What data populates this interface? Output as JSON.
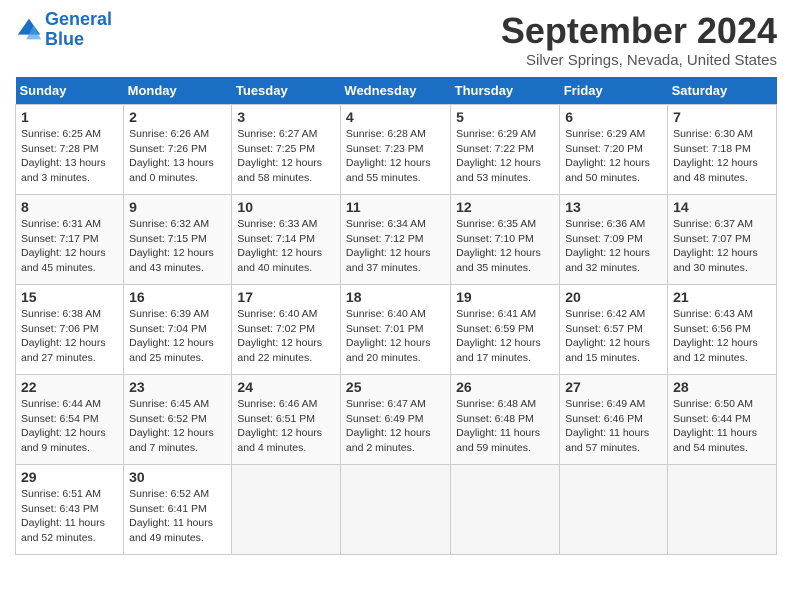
{
  "header": {
    "logo_line1": "General",
    "logo_line2": "Blue",
    "title": "September 2024",
    "location": "Silver Springs, Nevada, United States"
  },
  "weekdays": [
    "Sunday",
    "Monday",
    "Tuesday",
    "Wednesday",
    "Thursday",
    "Friday",
    "Saturday"
  ],
  "weeks": [
    [
      {
        "day": "1",
        "sunrise": "Sunrise: 6:25 AM",
        "sunset": "Sunset: 7:28 PM",
        "daylight": "Daylight: 13 hours and 3 minutes."
      },
      {
        "day": "2",
        "sunrise": "Sunrise: 6:26 AM",
        "sunset": "Sunset: 7:26 PM",
        "daylight": "Daylight: 13 hours and 0 minutes."
      },
      {
        "day": "3",
        "sunrise": "Sunrise: 6:27 AM",
        "sunset": "Sunset: 7:25 PM",
        "daylight": "Daylight: 12 hours and 58 minutes."
      },
      {
        "day": "4",
        "sunrise": "Sunrise: 6:28 AM",
        "sunset": "Sunset: 7:23 PM",
        "daylight": "Daylight: 12 hours and 55 minutes."
      },
      {
        "day": "5",
        "sunrise": "Sunrise: 6:29 AM",
        "sunset": "Sunset: 7:22 PM",
        "daylight": "Daylight: 12 hours and 53 minutes."
      },
      {
        "day": "6",
        "sunrise": "Sunrise: 6:29 AM",
        "sunset": "Sunset: 7:20 PM",
        "daylight": "Daylight: 12 hours and 50 minutes."
      },
      {
        "day": "7",
        "sunrise": "Sunrise: 6:30 AM",
        "sunset": "Sunset: 7:18 PM",
        "daylight": "Daylight: 12 hours and 48 minutes."
      }
    ],
    [
      {
        "day": "8",
        "sunrise": "Sunrise: 6:31 AM",
        "sunset": "Sunset: 7:17 PM",
        "daylight": "Daylight: 12 hours and 45 minutes."
      },
      {
        "day": "9",
        "sunrise": "Sunrise: 6:32 AM",
        "sunset": "Sunset: 7:15 PM",
        "daylight": "Daylight: 12 hours and 43 minutes."
      },
      {
        "day": "10",
        "sunrise": "Sunrise: 6:33 AM",
        "sunset": "Sunset: 7:14 PM",
        "daylight": "Daylight: 12 hours and 40 minutes."
      },
      {
        "day": "11",
        "sunrise": "Sunrise: 6:34 AM",
        "sunset": "Sunset: 7:12 PM",
        "daylight": "Daylight: 12 hours and 37 minutes."
      },
      {
        "day": "12",
        "sunrise": "Sunrise: 6:35 AM",
        "sunset": "Sunset: 7:10 PM",
        "daylight": "Daylight: 12 hours and 35 minutes."
      },
      {
        "day": "13",
        "sunrise": "Sunrise: 6:36 AM",
        "sunset": "Sunset: 7:09 PM",
        "daylight": "Daylight: 12 hours and 32 minutes."
      },
      {
        "day": "14",
        "sunrise": "Sunrise: 6:37 AM",
        "sunset": "Sunset: 7:07 PM",
        "daylight": "Daylight: 12 hours and 30 minutes."
      }
    ],
    [
      {
        "day": "15",
        "sunrise": "Sunrise: 6:38 AM",
        "sunset": "Sunset: 7:06 PM",
        "daylight": "Daylight: 12 hours and 27 minutes."
      },
      {
        "day": "16",
        "sunrise": "Sunrise: 6:39 AM",
        "sunset": "Sunset: 7:04 PM",
        "daylight": "Daylight: 12 hours and 25 minutes."
      },
      {
        "day": "17",
        "sunrise": "Sunrise: 6:40 AM",
        "sunset": "Sunset: 7:02 PM",
        "daylight": "Daylight: 12 hours and 22 minutes."
      },
      {
        "day": "18",
        "sunrise": "Sunrise: 6:40 AM",
        "sunset": "Sunset: 7:01 PM",
        "daylight": "Daylight: 12 hours and 20 minutes."
      },
      {
        "day": "19",
        "sunrise": "Sunrise: 6:41 AM",
        "sunset": "Sunset: 6:59 PM",
        "daylight": "Daylight: 12 hours and 17 minutes."
      },
      {
        "day": "20",
        "sunrise": "Sunrise: 6:42 AM",
        "sunset": "Sunset: 6:57 PM",
        "daylight": "Daylight: 12 hours and 15 minutes."
      },
      {
        "day": "21",
        "sunrise": "Sunrise: 6:43 AM",
        "sunset": "Sunset: 6:56 PM",
        "daylight": "Daylight: 12 hours and 12 minutes."
      }
    ],
    [
      {
        "day": "22",
        "sunrise": "Sunrise: 6:44 AM",
        "sunset": "Sunset: 6:54 PM",
        "daylight": "Daylight: 12 hours and 9 minutes."
      },
      {
        "day": "23",
        "sunrise": "Sunrise: 6:45 AM",
        "sunset": "Sunset: 6:52 PM",
        "daylight": "Daylight: 12 hours and 7 minutes."
      },
      {
        "day": "24",
        "sunrise": "Sunrise: 6:46 AM",
        "sunset": "Sunset: 6:51 PM",
        "daylight": "Daylight: 12 hours and 4 minutes."
      },
      {
        "day": "25",
        "sunrise": "Sunrise: 6:47 AM",
        "sunset": "Sunset: 6:49 PM",
        "daylight": "Daylight: 12 hours and 2 minutes."
      },
      {
        "day": "26",
        "sunrise": "Sunrise: 6:48 AM",
        "sunset": "Sunset: 6:48 PM",
        "daylight": "Daylight: 11 hours and 59 minutes."
      },
      {
        "day": "27",
        "sunrise": "Sunrise: 6:49 AM",
        "sunset": "Sunset: 6:46 PM",
        "daylight": "Daylight: 11 hours and 57 minutes."
      },
      {
        "day": "28",
        "sunrise": "Sunrise: 6:50 AM",
        "sunset": "Sunset: 6:44 PM",
        "daylight": "Daylight: 11 hours and 54 minutes."
      }
    ],
    [
      {
        "day": "29",
        "sunrise": "Sunrise: 6:51 AM",
        "sunset": "Sunset: 6:43 PM",
        "daylight": "Daylight: 11 hours and 52 minutes."
      },
      {
        "day": "30",
        "sunrise": "Sunrise: 6:52 AM",
        "sunset": "Sunset: 6:41 PM",
        "daylight": "Daylight: 11 hours and 49 minutes."
      },
      null,
      null,
      null,
      null,
      null
    ]
  ]
}
